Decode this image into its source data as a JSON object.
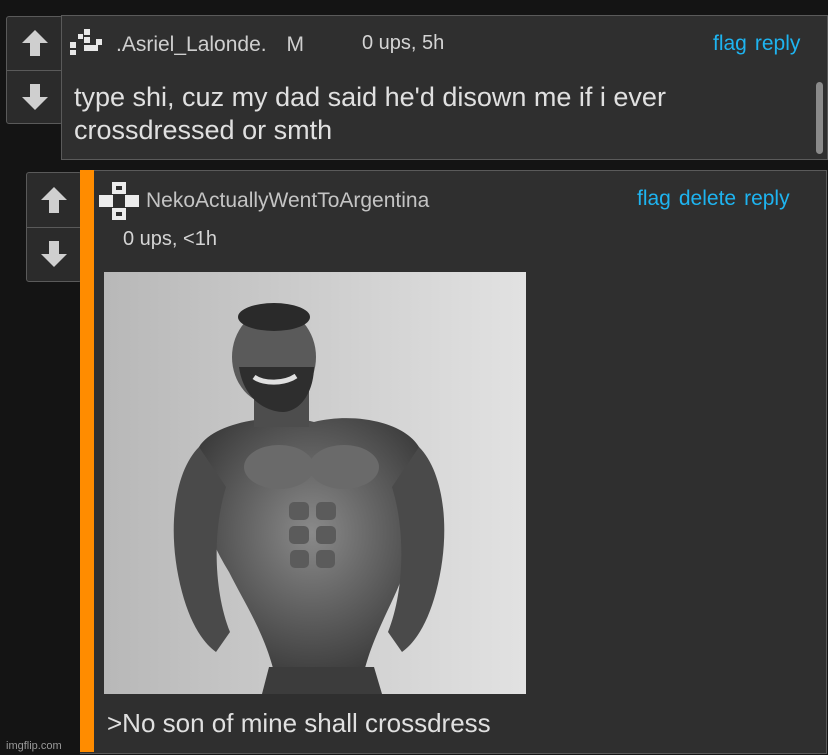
{
  "comment1": {
    "username": ".Asriel_Lalonde.",
    "badge": "M",
    "meta": "0 ups, 5h",
    "actions": [
      "flag",
      "reply"
    ],
    "text_line1": "type shi, cuz my dad said he'd disown me if i ever",
    "text_line2": "crossdressed or smth"
  },
  "comment2": {
    "username": "NekoActuallyWentToArgentina",
    "meta": "0 ups, <1h",
    "actions": [
      "flag",
      "delete",
      "reply"
    ],
    "caption": ">No son of mine shall crossdress",
    "accent_color": "#ff8c00"
  },
  "colors": {
    "link": "#1eb4f0",
    "background": "#141414",
    "panel": "#2f2f2f"
  },
  "icons": [
    "up-arrow-icon",
    "down-arrow-icon"
  ],
  "watermark": "imgflip.com"
}
